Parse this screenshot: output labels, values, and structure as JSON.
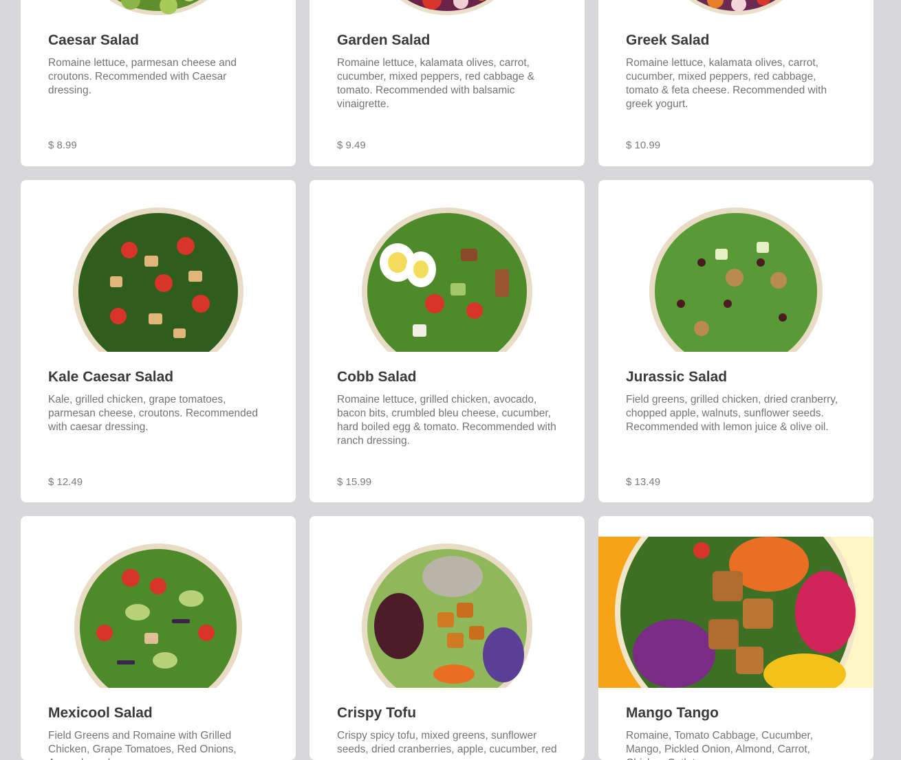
{
  "menu": {
    "items": [
      {
        "name": "Caesar Salad",
        "description": "Romaine lettuce, parmesan cheese and croutons. Recommended with Caesar dressing.",
        "price": "$ 8.99",
        "image_icon": "caesar-salad-bowl"
      },
      {
        "name": "Garden Salad",
        "description": "Romaine lettuce, kalamata olives, carrot, cucumber, mixed peppers, red cabbage & tomato. Recommended with balsamic vinaigrette.",
        "price": "$ 9.49",
        "image_icon": "garden-salad-bowl"
      },
      {
        "name": "Greek Salad",
        "description": "Romaine lettuce, kalamata olives, carrot, cucumber, mixed peppers, red cabbage, tomato & feta cheese. Recommended with greek yogurt.",
        "price": "$ 10.99",
        "image_icon": "greek-salad-bowl"
      },
      {
        "name": "Kale Caesar Salad",
        "description": "Kale, grilled chicken, grape tomatoes, parmesan cheese, croutons. Recommended with caesar dressing.",
        "price": "$ 12.49",
        "image_icon": "kale-caesar-salad-bowl"
      },
      {
        "name": "Cobb Salad",
        "description": "Romaine lettuce, grilled chicken, avocado, bacon bits, crumbled bleu cheese, cucumber, hard boiled egg & tomato. Recommended with ranch dressing.",
        "price": "$ 15.99",
        "image_icon": "cobb-salad-bowl"
      },
      {
        "name": "Jurassic Salad",
        "description": "Field greens, grilled chicken, dried cranberry, chopped apple, walnuts, sunflower seeds. Recommended with lemon juice & olive oil.",
        "price": "$ 13.49",
        "image_icon": "jurassic-salad-bowl"
      },
      {
        "name": "Mexicool Salad",
        "description": "Field Greens and Romaine with Grilled Chicken, Grape Tomatoes, Red Onions, Avocado and",
        "price": "",
        "image_icon": "mexicool-salad-bowl"
      },
      {
        "name": "Crispy Tofu",
        "description": "Crispy spicy tofu, mixed greens, sunflower seeds, dried cranberries, apple, cucumber, red",
        "price": "",
        "image_icon": "crispy-tofu-bowl"
      },
      {
        "name": "Mango Tango",
        "description": "Romaine, Tomato Cabbage, Cucumber, Mango, Pickled Onion, Almond, Carrot, Chicken Cutlet",
        "price": "",
        "image_icon": "mango-tango-bowl"
      }
    ]
  },
  "colors": {
    "page_background": "#d8d8da",
    "card_background": "#ffffff",
    "title": "#3a3a3a",
    "text": "#747474",
    "mango_banner_orange": "#f6a318",
    "mango_banner_cream": "#fff6c4"
  }
}
